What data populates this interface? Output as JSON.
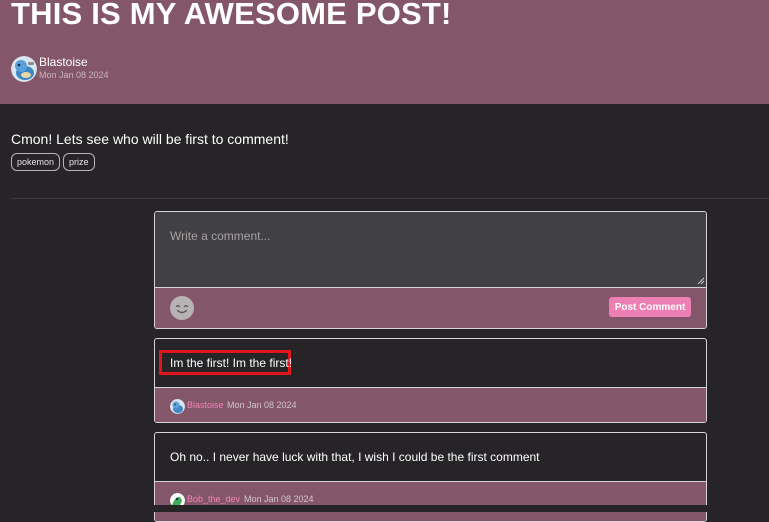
{
  "post": {
    "title": "THIS IS MY AWESOME POST!",
    "author": "Blastoise",
    "date": "Mon Jan 08 2024",
    "body": "Cmon! Lets see who will be first to comment!",
    "tags": [
      "pokemon",
      "prize"
    ]
  },
  "comment_form": {
    "placeholder": "Write a comment...",
    "emoji_icon": "smiley-face-icon",
    "submit_label": "Post Comment"
  },
  "comments": [
    {
      "text": "Im the first! Im the first!",
      "user": "Blastoise",
      "date": "Mon Jan 08 2024"
    },
    {
      "text": "Oh no.. I never have luck with that, I wish I could be the first comment",
      "user": "Bob_the_dev",
      "date": "Mon Jan 08 2024"
    }
  ],
  "colors": {
    "header_bg": "#845669",
    "page_bg": "#262427",
    "accent_pink": "#ee7fb4",
    "highlight_red": "#e3141b"
  }
}
